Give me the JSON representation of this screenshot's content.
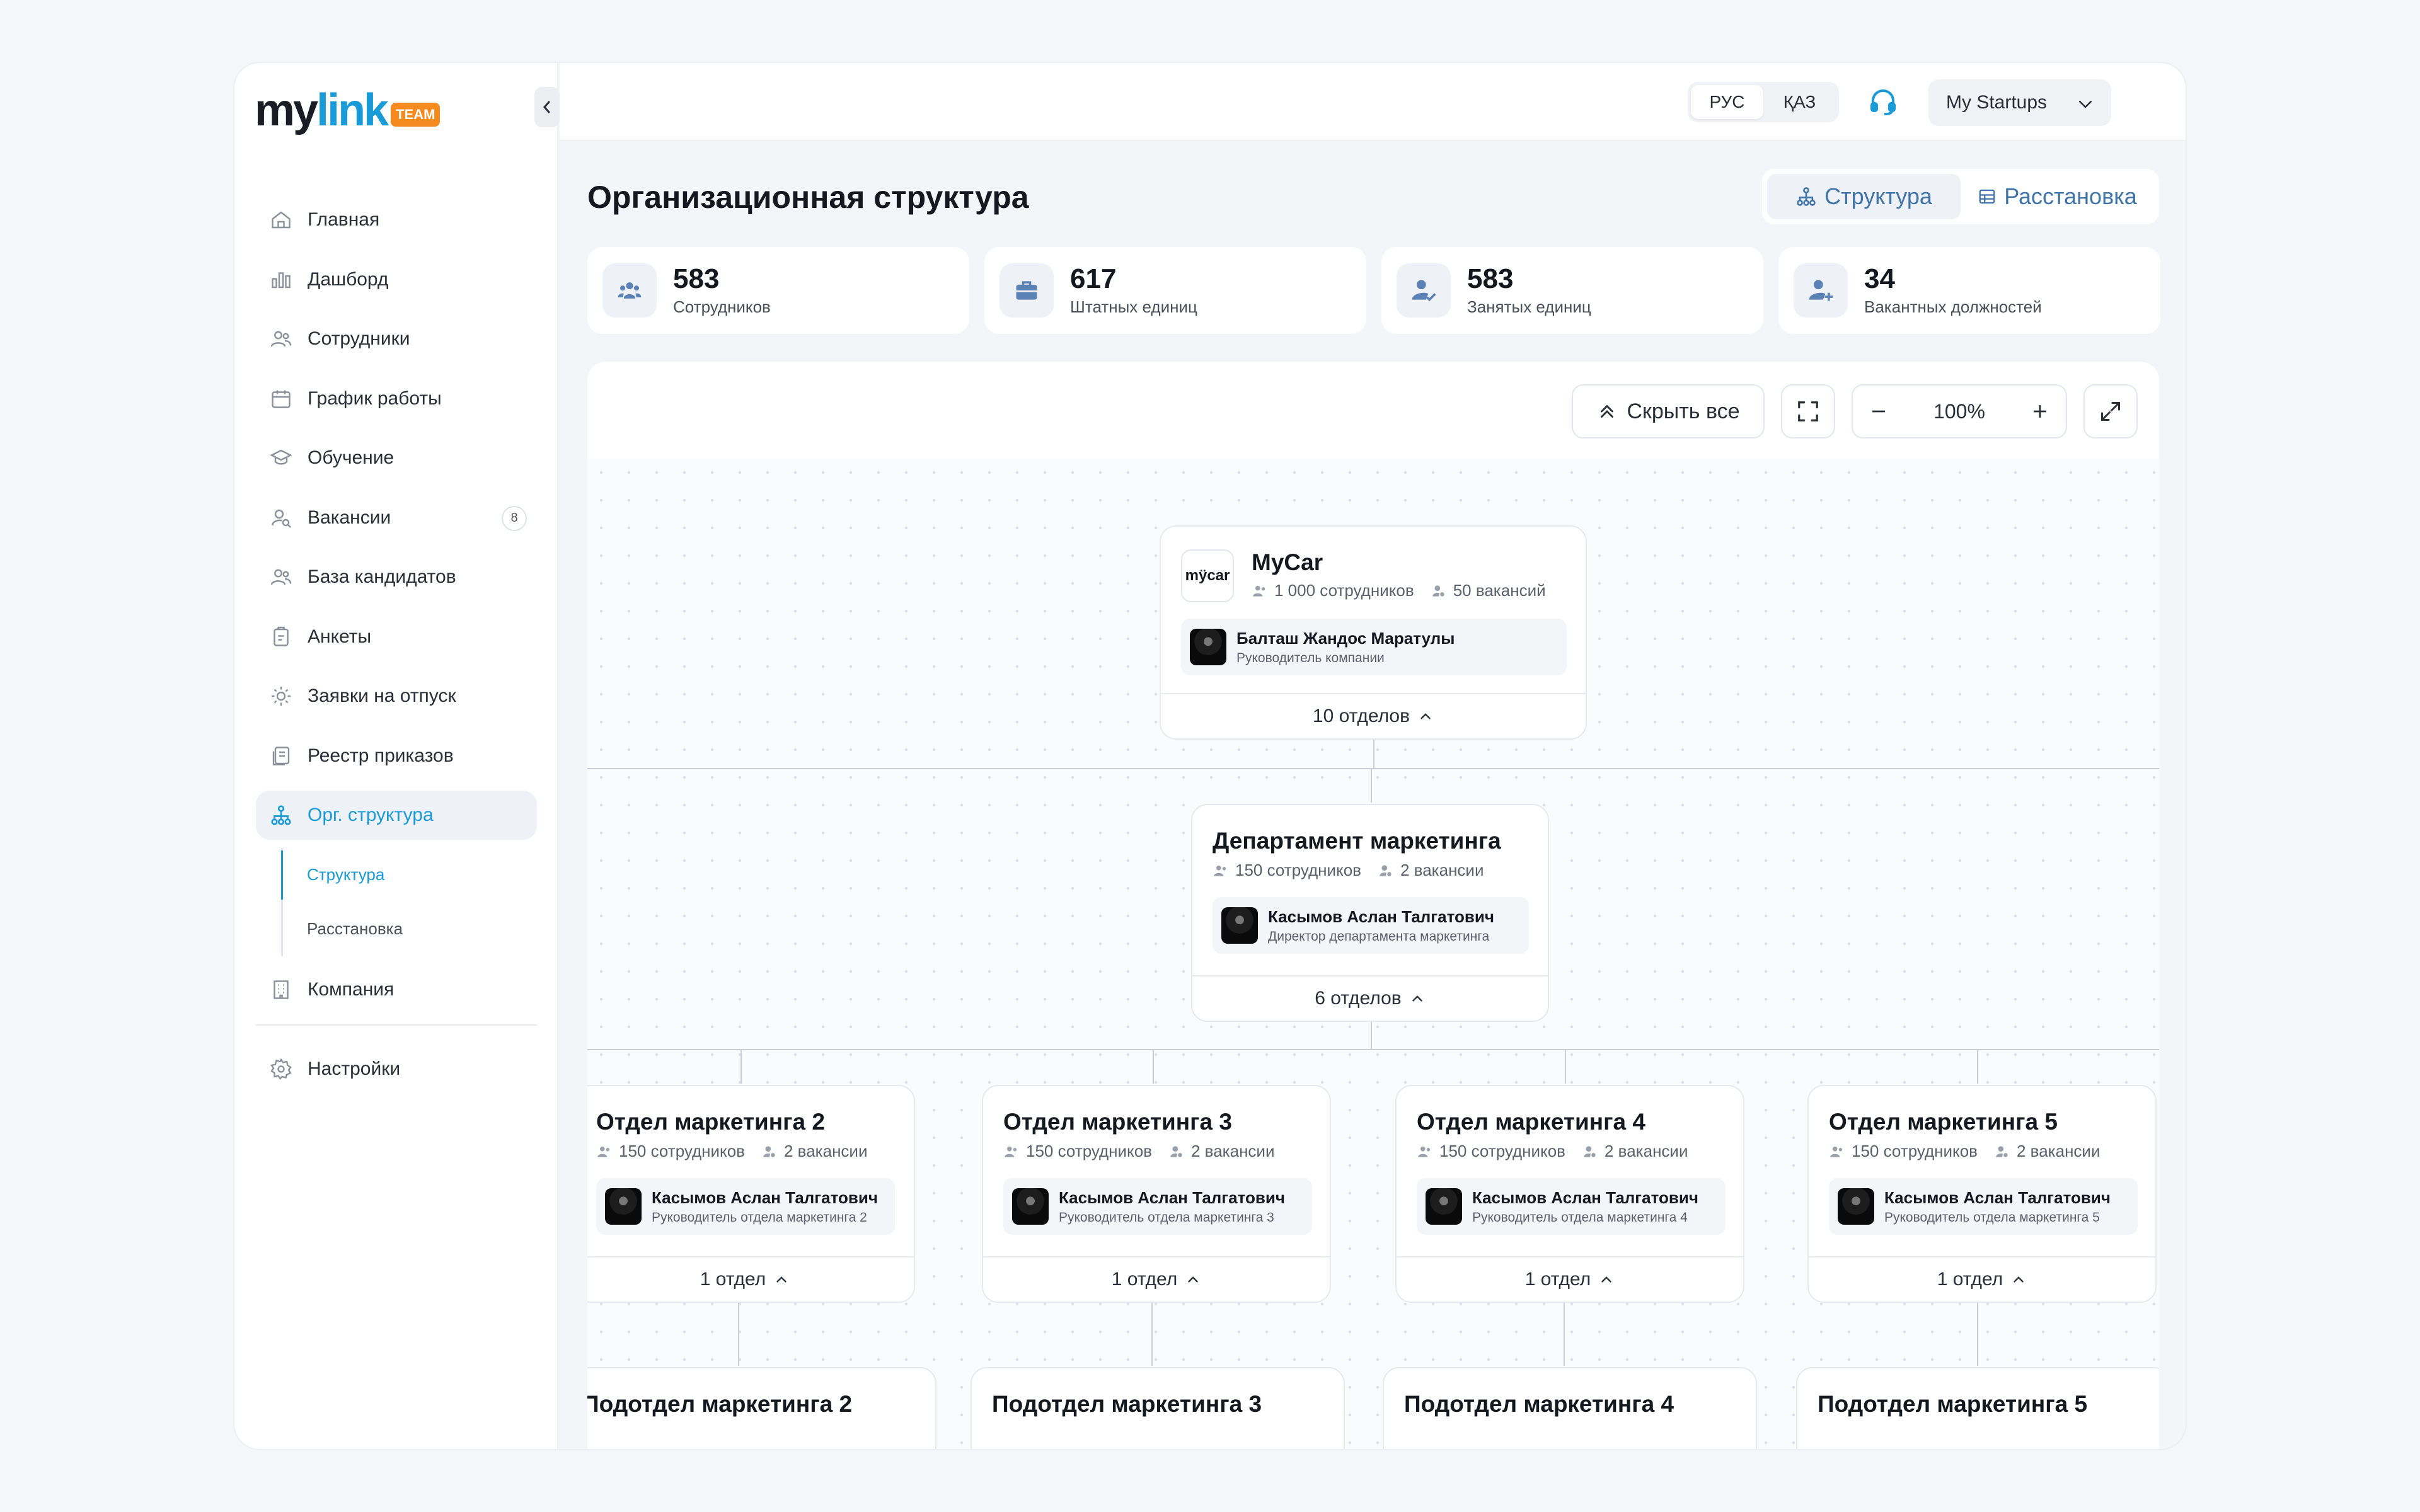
{
  "brand": {
    "name_my": "my",
    "name_link": "link",
    "badge": "TEAM"
  },
  "sidebar": {
    "items": [
      {
        "label": "Главная",
        "icon": "home-icon"
      },
      {
        "label": "Дашборд",
        "icon": "chart-icon"
      },
      {
        "label": "Сотрудники",
        "icon": "users-icon"
      },
      {
        "label": "График работы",
        "icon": "calendar-icon"
      },
      {
        "label": "Обучение",
        "icon": "graduation-icon"
      },
      {
        "label": "Вакансии",
        "icon": "user-search-icon",
        "badge": "8"
      },
      {
        "label": "База кандидатов",
        "icon": "users-icon"
      },
      {
        "label": "Анкеты",
        "icon": "clipboard-icon"
      },
      {
        "label": "Заявки на отпуск",
        "icon": "sun-icon"
      },
      {
        "label": "Реестр приказов",
        "icon": "documents-icon"
      },
      {
        "label": "Орг. структура",
        "icon": "hierarchy-icon",
        "active": true
      },
      {
        "label": "Компания",
        "icon": "building-icon"
      },
      {
        "label": "Настройки",
        "icon": "gear-icon"
      }
    ],
    "sub": [
      {
        "label": "Структура",
        "active": true
      },
      {
        "label": "Расстановка"
      }
    ]
  },
  "topbar": {
    "lang": [
      "РУС",
      "ҚАЗ"
    ],
    "workspace": "My Startups"
  },
  "page": {
    "title": "Организационная структура",
    "view": [
      "Структура",
      "Расстановка"
    ]
  },
  "stats": [
    {
      "value": "583",
      "label": "Сотрудников"
    },
    {
      "value": "617",
      "label": "Штатных единиц"
    },
    {
      "value": "583",
      "label": "Занятых единиц"
    },
    {
      "value": "34",
      "label": "Вакантных должностей"
    }
  ],
  "toolbar": {
    "hide_all": "Скрыть все",
    "zoom": "100%"
  },
  "colors": {
    "accent": "#1a9bd8",
    "orange": "#f58a1f",
    "toggle_text": "#3f74a8"
  },
  "org": {
    "root": {
      "logo": "mÿcar",
      "name": "MyCar",
      "employees": "1 000 сотрудников",
      "vacancies": "50 вакансий",
      "manager": "Балташ Жандос Маратулы",
      "role": "Руководитель компании",
      "footer": "10 отделов"
    },
    "dept": {
      "name": "Департамент маркетинга",
      "employees": "150 сотрудников",
      "vacancies": "2 вакансии",
      "manager": "Касымов Аслан Талгатович",
      "role": "Директор департамента маркетинга",
      "footer": "6 отделов"
    },
    "units": [
      {
        "name": "Отдел маркетинга 2",
        "employees": "150 сотрудников",
        "vacancies": "2 вакансии",
        "manager": "Касымов Аслан Талгатович",
        "role": "Руководитель отдела маркетинга 2",
        "footer": "1 отдел",
        "child": "Подотдел маркетинга 2"
      },
      {
        "name": "Отдел маркетинга 3",
        "employees": "150 сотрудников",
        "vacancies": "2 вакансии",
        "manager": "Касымов Аслан Талгатович",
        "role": "Руководитель отдела маркетинга 3",
        "footer": "1 отдел",
        "child": "Подотдел маркетинга 3"
      },
      {
        "name": "Отдел маркетинга 4",
        "employees": "150 сотрудников",
        "vacancies": "2 вакансии",
        "manager": "Касымов Аслан Талгатович",
        "role": "Руководитель отдела маркетинга 4",
        "footer": "1 отдел",
        "child": "Подотдел маркетинга 4"
      },
      {
        "name": "Отдел маркетинга 5",
        "employees": "150 сотрудников",
        "vacancies": "2 вакансии",
        "manager": "Касымов Аслан Талгатович",
        "role": "Руководитель отдела маркетинга 5",
        "footer": "1 отдел",
        "child": "Подотдел маркетинга 5"
      }
    ]
  }
}
